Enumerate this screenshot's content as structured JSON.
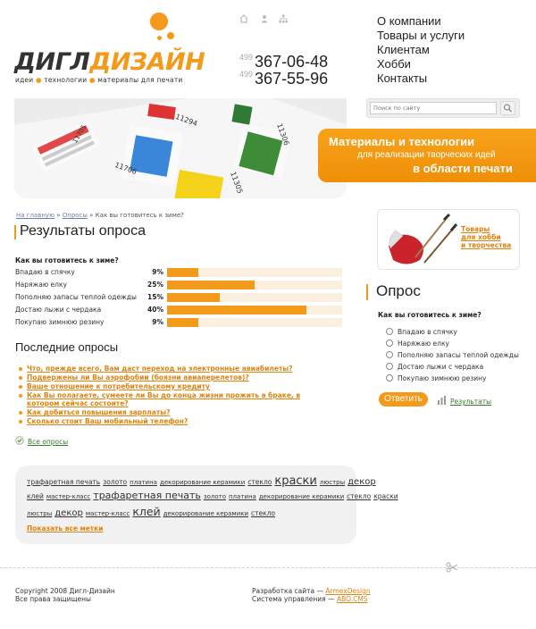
{
  "logo": {
    "name_part1": "ДИГЛ",
    "name_part2": "ДИЗАЙН",
    "tagline": [
      "идеи",
      "технологии",
      "материалы для печати"
    ]
  },
  "top_icons": [
    "home-icon",
    "user-icon",
    "sitemap-icon"
  ],
  "phones": [
    {
      "code": "499",
      "number": "367-06-48"
    },
    {
      "code": "499",
      "number": "367-55-96"
    }
  ],
  "nav": [
    "О компании",
    "Товары и услуги",
    "Клиентам",
    "Хобби",
    "Контакты"
  ],
  "search": {
    "placeholder": "Поиск по сайту"
  },
  "banner": {
    "promo_title": "Материалы и технологии",
    "promo_line2": "для реализации творческих идей",
    "promo_line3": "в области печати",
    "swatch_codes": [
      "11294",
      "11706",
      "11306",
      "11305",
      "11705"
    ]
  },
  "breadcrumb": {
    "home": "На главную",
    "sep": "»",
    "polls": "Опросы",
    "current": "Как вы готовитесь к зиме?"
  },
  "results": {
    "title": "Результаты опроса",
    "question": "Как вы готовитесь к зиме?",
    "rows": [
      {
        "label": "Впадаю в спячку",
        "pct": "9%",
        "value": 9
      },
      {
        "label": "Наряжаю елку",
        "pct": "25%",
        "value": 25
      },
      {
        "label": "Пополняю запасы теплой одежды",
        "pct": "15%",
        "value": 15
      },
      {
        "label": "Достаю лыжи с чердака",
        "pct": "40%",
        "value": 40
      },
      {
        "label": "Покупаю зимнюю резину",
        "pct": "9%",
        "value": 9
      }
    ]
  },
  "last_polls": {
    "title": "Последние опросы",
    "items": [
      "Что, прежде всего, Вам даст переход на электронные авиабилеты?",
      "Подвержены ли Вы аэрофобии (боязни авиаперелетов)?",
      "Ваше отношение к потребительскому кредиту",
      "Как Вы полагаете, сумеете ли Вы до конца жизни прожить в браке, в котором сейчас состоите?",
      "Как добиться повышения зарплаты?",
      "Сколько стоит Ваш мобильный телефон?"
    ],
    "all_label": "Все опросы"
  },
  "tags": {
    "lines": [
      [
        {
          "t": "трафаретная печать",
          "s": 7.5
        },
        {
          "t": "золото",
          "s": 7.5
        },
        {
          "t": "платина",
          "s": 7
        },
        {
          "t": "декорирование керамики",
          "s": 7
        },
        {
          "t": "стекло",
          "s": 7.5
        },
        {
          "t": "краски",
          "s": 13
        },
        {
          "t": "люстры",
          "s": 7
        },
        {
          "t": "декор",
          "s": 10
        }
      ],
      [
        {
          "t": "клей",
          "s": 7.5
        },
        {
          "t": "мастер-класс",
          "s": 7
        },
        {
          "t": "трафаретная печать",
          "s": 11
        },
        {
          "t": "золото",
          "s": 7
        },
        {
          "t": "платина",
          "s": 7
        },
        {
          "t": "декорирование керамики",
          "s": 7
        },
        {
          "t": "стекло",
          "s": 7.5
        },
        {
          "t": "краски",
          "s": 7.5
        }
      ],
      [
        {
          "t": "люстры",
          "s": 7
        },
        {
          "t": "декор",
          "s": 10
        },
        {
          "t": "мастер-класс",
          "s": 7
        },
        {
          "t": "клей",
          "s": 12.5
        },
        {
          "t": "декорирование керамики",
          "s": 7
        },
        {
          "t": "стекло",
          "s": 7.5
        }
      ]
    ],
    "show_all": "Показать все метки"
  },
  "ad": {
    "link_lines": [
      "Товары",
      "для хобби",
      "и творчества"
    ]
  },
  "poll": {
    "title": "Опрос",
    "question": "Как вы готовитесь к зиме?",
    "options": [
      "Впадаю в спячку",
      "Наряжаю елку",
      "Пополняю запасы теплой одежды",
      "Достаю лыжи с чердака",
      "Покупаю зимнюю резину"
    ],
    "vote": "Ответить",
    "results": "Результаты"
  },
  "footer": {
    "copyright": "Copyright 2008 Дигл-Дизайн",
    "rights": "Все права защищены",
    "dev_label": "Разработка сайта —",
    "dev_link": "ArmexDesign",
    "cms_label": "Система управления —",
    "cms_link": "ABO.CMS"
  }
}
